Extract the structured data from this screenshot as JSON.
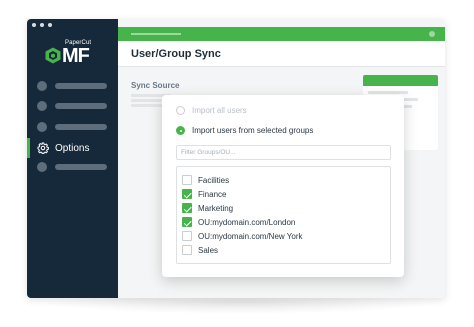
{
  "window": {
    "brand_small": "PaperCut",
    "brand_large": "MF",
    "page_title": "User/Group Sync"
  },
  "sidebar": {
    "options_label": "Options"
  },
  "main": {
    "section_label": "Sync Source"
  },
  "modal": {
    "radio_all": "Import all users",
    "radio_selected": "Import users from selected groups",
    "selected_radio": "selected",
    "filter_placeholder": "Filter Groups/OU...",
    "groups": [
      {
        "label": "Facilities",
        "checked": false
      },
      {
        "label": "Finance",
        "checked": true
      },
      {
        "label": "Marketing",
        "checked": true
      },
      {
        "label": "OU:mydomain.com/London",
        "checked": true
      },
      {
        "label": "OU:mydomain.com/New York",
        "checked": false
      },
      {
        "label": "Sales",
        "checked": false
      }
    ]
  },
  "colors": {
    "accent_green": "#47b44b",
    "sidebar_navy": "#15293a"
  }
}
